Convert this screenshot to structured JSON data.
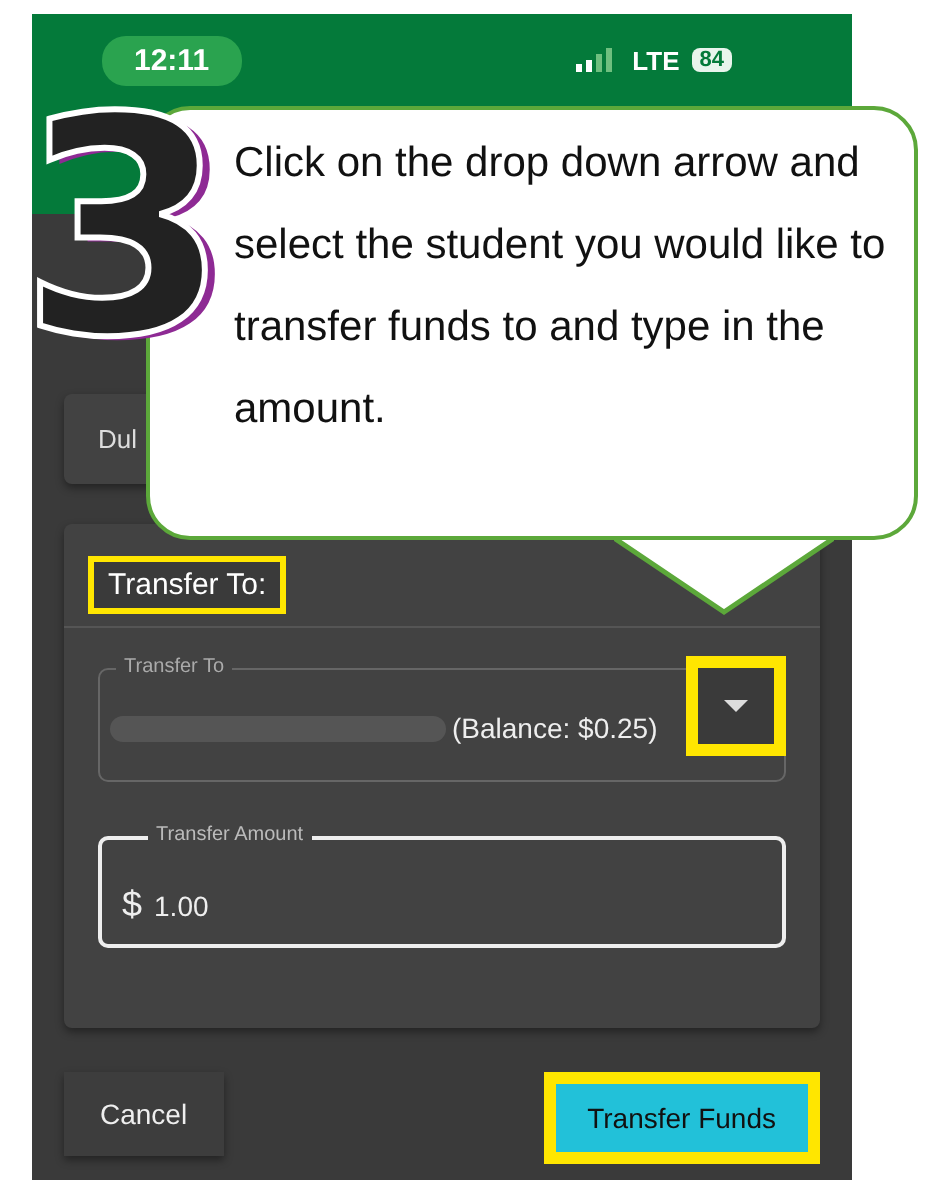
{
  "status_bar": {
    "time": "12:11",
    "network": "LTE",
    "battery": "84"
  },
  "card": {
    "partial_text": "Dul"
  },
  "section": {
    "title": "Transfer To:",
    "highlighted": true
  },
  "transfer_to": {
    "label": "Transfer To",
    "value": "(Balance: $0.25)",
    "dropdown_highlighted": true
  },
  "amount": {
    "label": "Transfer Amount",
    "prefix": "$",
    "value": "1.00"
  },
  "buttons": [
    {
      "label": "Cancel",
      "kind": "secondary",
      "highlighted": false
    },
    {
      "label": "Transfer Funds",
      "kind": "primary",
      "highlighted": true
    }
  ],
  "callout": {
    "step": "3",
    "text": "Click on the drop down arrow and select the student you would like to transfer funds to and type in the amount."
  }
}
